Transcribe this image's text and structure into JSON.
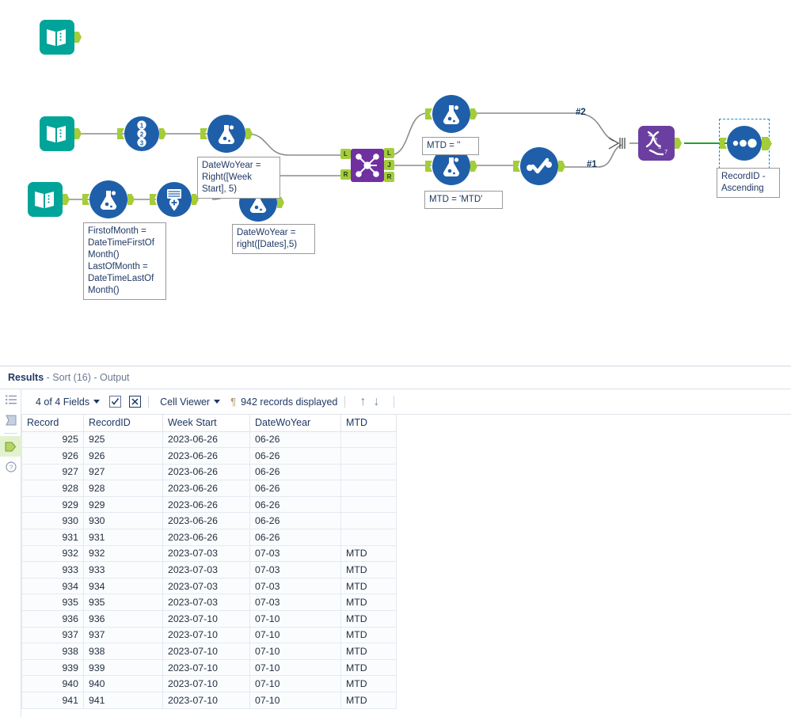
{
  "canvas": {
    "annotations": [
      {
        "id": "ann_firstofmonth",
        "text": "FirstofMonth =\nDateTimeFirstOf\nMonth()\nLastOfMonth =\nDateTimeLastOf\nMonth()"
      },
      {
        "id": "ann_datewoyear_weekstart",
        "text": "DateWoYear =\nRight([Week\nStart], 5)"
      },
      {
        "id": "ann_datewoyear_dates",
        "text": "DateWoYear =\nright([Dates],5)"
      },
      {
        "id": "ann_mtd_empty",
        "text": "MTD = ''"
      },
      {
        "id": "ann_mtd_mtd",
        "text": "MTD = 'MTD'"
      },
      {
        "id": "ann_sort",
        "text": "RecordID -\nAscending"
      }
    ],
    "wire_labels": [
      {
        "id": "wire_2",
        "text": "#2"
      },
      {
        "id": "wire_1",
        "text": "#1"
      }
    ],
    "join_anchors": {
      "left": "L",
      "join": "J",
      "right": "R"
    },
    "tools": [
      {
        "id": "input1",
        "name": "input-data-tool",
        "label": "Input Data"
      },
      {
        "id": "input2",
        "name": "input-data-tool",
        "label": "Input Data"
      },
      {
        "id": "input3",
        "name": "input-data-tool",
        "label": "Input Data"
      },
      {
        "id": "recordid",
        "name": "record-id-tool",
        "label": "Record ID"
      },
      {
        "id": "formula1",
        "name": "formula-tool",
        "label": "Formula"
      },
      {
        "id": "formula2",
        "name": "formula-tool",
        "label": "Formula"
      },
      {
        "id": "generaterows",
        "name": "generate-rows-tool",
        "label": "Generate Rows"
      },
      {
        "id": "formula3",
        "name": "formula-tool",
        "label": "Formula"
      },
      {
        "id": "join",
        "name": "join-tool",
        "label": "Join"
      },
      {
        "id": "formula_top",
        "name": "formula-tool",
        "label": "Formula"
      },
      {
        "id": "formula_bottom",
        "name": "formula-tool",
        "label": "Formula"
      },
      {
        "id": "select",
        "name": "select-tool",
        "label": "Select"
      },
      {
        "id": "union",
        "name": "union-tool",
        "label": "Union"
      },
      {
        "id": "sort",
        "name": "sort-tool",
        "label": "Sort"
      },
      {
        "id": "browse",
        "name": "browse-tool",
        "label": "Browse"
      }
    ],
    "colors": {
      "input_teal": "#00a499",
      "tool_blue": "#1f5fa9",
      "purple": "#6b3fa0",
      "join_purple": "#7030a0",
      "anchor_green": "#a4cd39",
      "wire_gray": "#8c8c8c",
      "wire_active_green": "#2ca02c",
      "selection_blue": "#1b8ad6"
    }
  },
  "results": {
    "title_bold": "Results",
    "title_rest": " - Sort (16) - Output",
    "rail": [
      {
        "name": "field-list-icon",
        "glyph": "list"
      },
      {
        "name": "metadata-icon",
        "glyph": "flag"
      },
      {
        "name": "output-anchor-icon",
        "glyph": "anchor",
        "active": true
      },
      {
        "name": "help-icon",
        "glyph": "help"
      }
    ],
    "toolbar": {
      "fields_label": "4 of 4 Fields",
      "check_button": "check-all",
      "uncheck_button": "uncheck-all",
      "cell_viewer_label": "Cell Viewer",
      "pilcrow": "¶",
      "records_label": "942 records displayed",
      "up_arrow": "↑",
      "down_arrow": "↓"
    },
    "grid": {
      "columns": [
        "Record",
        "RecordID",
        "Week Start",
        "DateWoYear",
        "MTD"
      ],
      "rows": [
        [
          "925",
          "925",
          "2023-06-26",
          "06-26",
          ""
        ],
        [
          "926",
          "926",
          "2023-06-26",
          "06-26",
          ""
        ],
        [
          "927",
          "927",
          "2023-06-26",
          "06-26",
          ""
        ],
        [
          "928",
          "928",
          "2023-06-26",
          "06-26",
          ""
        ],
        [
          "929",
          "929",
          "2023-06-26",
          "06-26",
          ""
        ],
        [
          "930",
          "930",
          "2023-06-26",
          "06-26",
          ""
        ],
        [
          "931",
          "931",
          "2023-06-26",
          "06-26",
          ""
        ],
        [
          "932",
          "932",
          "2023-07-03",
          "07-03",
          "MTD"
        ],
        [
          "933",
          "933",
          "2023-07-03",
          "07-03",
          "MTD"
        ],
        [
          "934",
          "934",
          "2023-07-03",
          "07-03",
          "MTD"
        ],
        [
          "935",
          "935",
          "2023-07-03",
          "07-03",
          "MTD"
        ],
        [
          "936",
          "936",
          "2023-07-10",
          "07-10",
          "MTD"
        ],
        [
          "937",
          "937",
          "2023-07-10",
          "07-10",
          "MTD"
        ],
        [
          "938",
          "938",
          "2023-07-10",
          "07-10",
          "MTD"
        ],
        [
          "939",
          "939",
          "2023-07-10",
          "07-10",
          "MTD"
        ],
        [
          "940",
          "940",
          "2023-07-10",
          "07-10",
          "MTD"
        ],
        [
          "941",
          "941",
          "2023-07-10",
          "07-10",
          "MTD"
        ]
      ]
    }
  }
}
